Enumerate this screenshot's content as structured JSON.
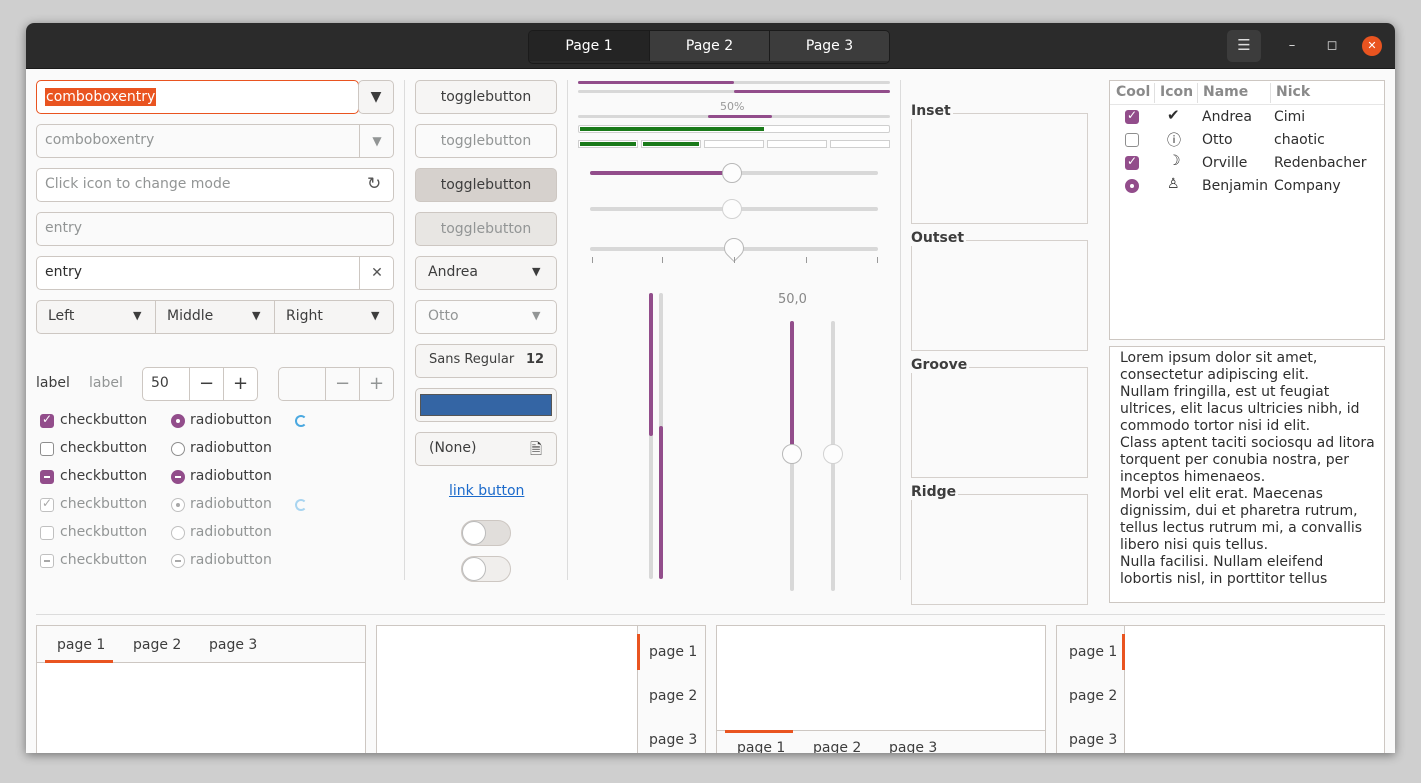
{
  "titlebar": {
    "stack_tabs": [
      "Page 1",
      "Page 2",
      "Page 3"
    ],
    "menu_icon": "hamburger-icon",
    "minimize_icon": "minimize-icon",
    "maximize_icon": "maximize-icon",
    "close_icon": "close-icon"
  },
  "col1": {
    "combo_entry_1": "comboboxentry",
    "combo_entry_2": "comboboxentry",
    "icon_entry_placeholder": "Click icon to change mode",
    "entry_disabled": "entry",
    "entry_value": "entry",
    "segmented": [
      "Left",
      "Middle",
      "Right"
    ],
    "label_1": "label",
    "label_2": "label",
    "spin_value": "50",
    "checks": [
      {
        "label": "checkbutton",
        "state": "checked"
      },
      {
        "label": "checkbutton",
        "state": "unchecked"
      },
      {
        "label": "checkbutton",
        "state": "mixed"
      },
      {
        "label": "checkbutton",
        "state": "checked-disabled"
      },
      {
        "label": "checkbutton",
        "state": "unchecked-disabled"
      },
      {
        "label": "checkbutton",
        "state": "mixed-disabled"
      }
    ],
    "radios": [
      {
        "label": "radiobutton",
        "state": "checked"
      },
      {
        "label": "radiobutton",
        "state": "unchecked"
      },
      {
        "label": "radiobutton",
        "state": "mixed"
      },
      {
        "label": "radiobutton",
        "state": "checked-disabled"
      },
      {
        "label": "radiobutton",
        "state": "unchecked-disabled"
      },
      {
        "label": "radiobutton",
        "state": "mixed-disabled"
      }
    ]
  },
  "col2": {
    "toggles": [
      "togglebutton",
      "togglebutton",
      "togglebutton",
      "togglebutton"
    ],
    "combo_1": "Andrea",
    "combo_2": "Otto",
    "font_name": "Sans Regular",
    "font_size": "12",
    "color_swatch": "#3465a4",
    "file_chooser": "(None)",
    "link": "link button"
  },
  "col3": {
    "progress_text": "50%",
    "scale_value": "50,0",
    "accent": "#924d8b",
    "level_color": "#1a7a1a"
  },
  "frames": {
    "labels": [
      "Inset",
      "Outset",
      "Groove",
      "Ridge"
    ]
  },
  "tree": {
    "headers": [
      "Cool",
      "Icon",
      "Name",
      "Nick"
    ],
    "rows": [
      {
        "cool": "checked",
        "icon": "check-circle-icon",
        "name": "Andrea",
        "nick": "Cimi"
      },
      {
        "cool": "unchecked",
        "icon": "warning-circle-icon",
        "name": "Otto",
        "nick": "chaotic"
      },
      {
        "cool": "checked",
        "icon": "face-icon",
        "name": "Orville",
        "nick": "Redenbacher"
      },
      {
        "cool": "radio",
        "icon": "person-icon",
        "name": "Benjamin",
        "nick": "Company"
      }
    ]
  },
  "textview": {
    "lines": [
      "Lorem ipsum dolor sit amet,",
      "consectetur adipiscing elit.",
      "Nullam fringilla, est ut feugiat",
      "ultrices, elit lacus ultricies nibh, id",
      "commodo tortor nisi id elit.",
      "Class aptent taciti sociosqu ad litora",
      "torquent per conubia nostra, per",
      "inceptos himenaeos.",
      "Morbi vel elit erat. Maecenas",
      "dignissim, dui et pharetra rutrum,",
      "tellus lectus rutrum mi, a convallis",
      "libero nisi quis tellus.",
      "Nulla facilisi. Nullam eleifend",
      "lobortis nisl, in porttitor tellus"
    ]
  },
  "notebooks": {
    "tabs": [
      "page 1",
      "page 2",
      "page 3"
    ]
  }
}
